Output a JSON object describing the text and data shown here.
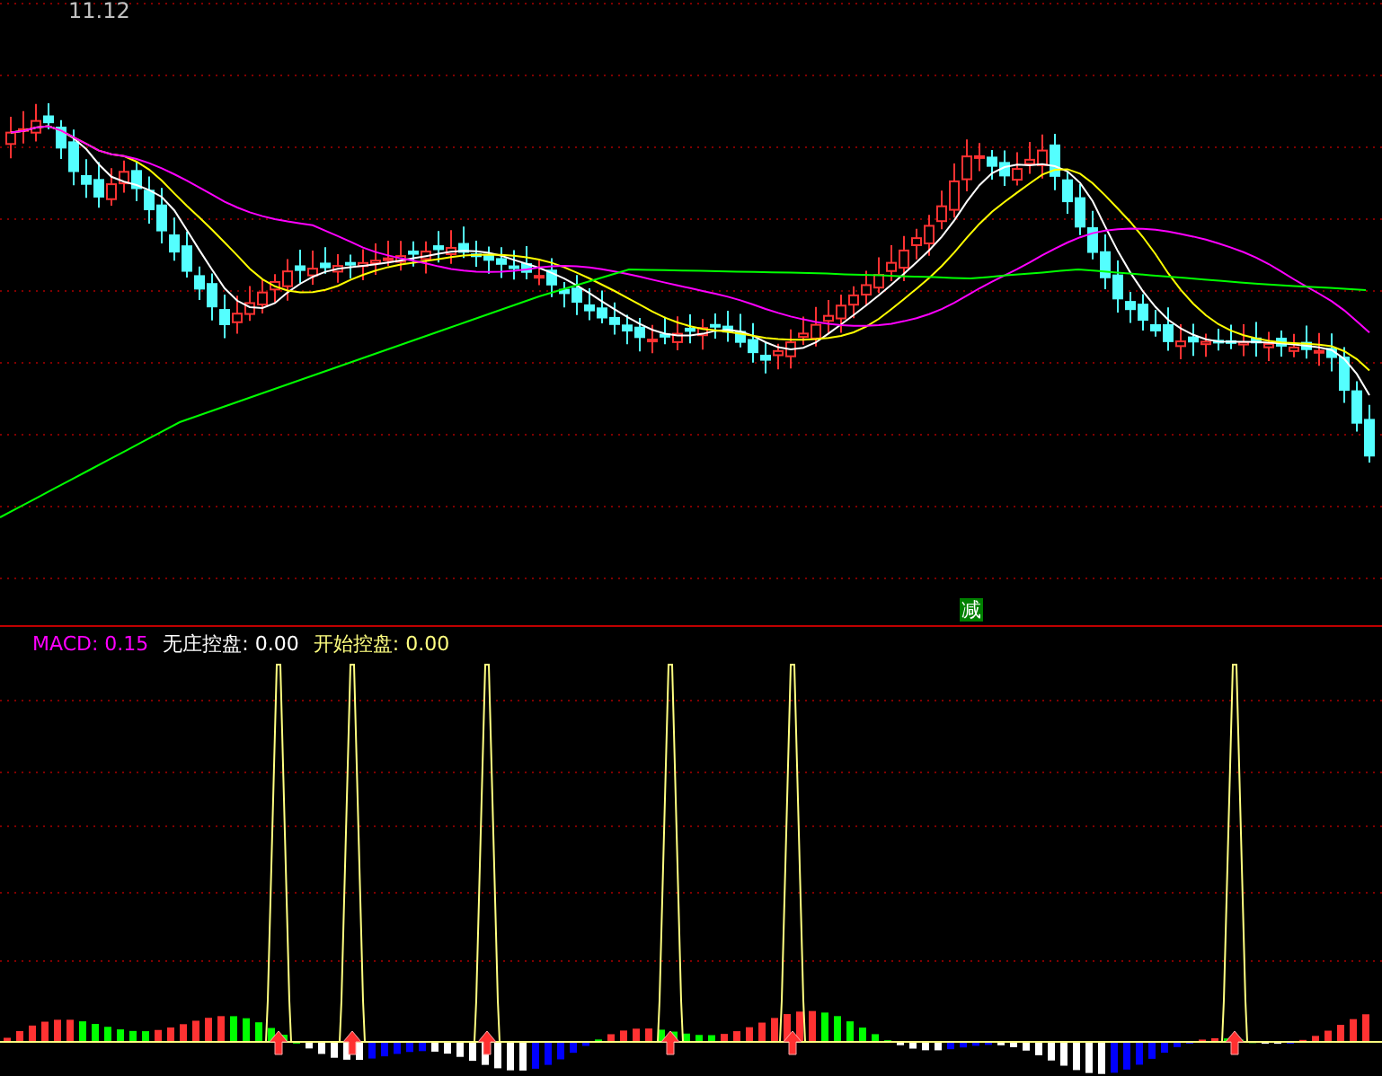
{
  "price_panel": {
    "price_label": "11.12",
    "signal_label": "减"
  },
  "indicator_panel": {
    "legend": [
      {
        "text": "MACD: 0.15",
        "color": "#ff00ff"
      },
      {
        "text": "无庄控盘: 0.00",
        "color": "#ffffff"
      },
      {
        "text": "开始控盘: 0.00",
        "color": "#ffff80"
      }
    ]
  }
}
